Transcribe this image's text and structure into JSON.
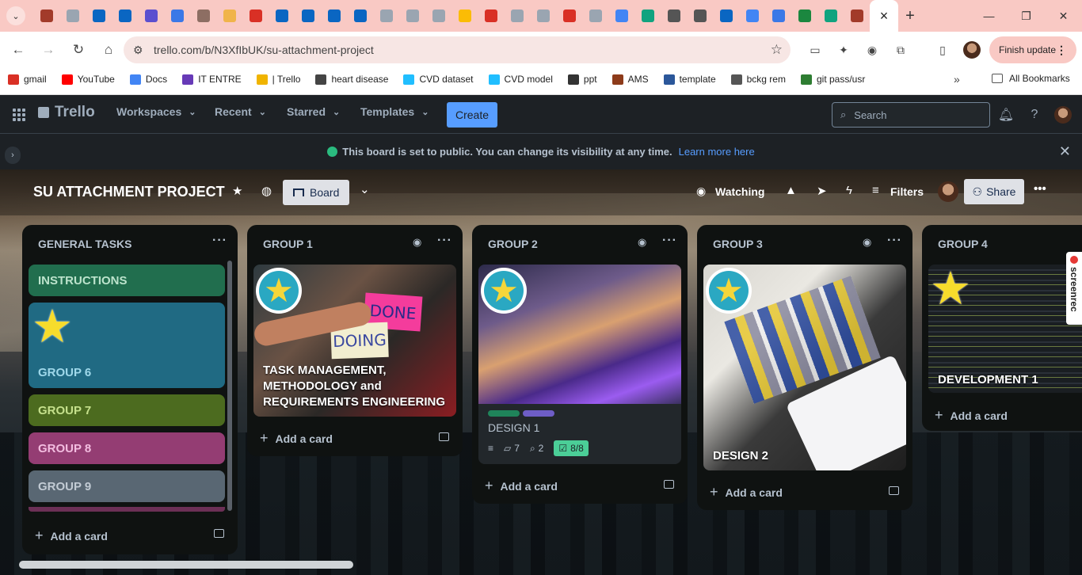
{
  "browser": {
    "tab_count_favicons": [
      "#a23b2a",
      "#9aa5b1",
      "#0a66c2",
      "#0a66c2",
      "#5b4fcf",
      "#3b78e7",
      "#8d6e63",
      "#f0b44a",
      "#d93025",
      "#0a66c2",
      "#0a66c2",
      "#0a66c2",
      "#0a66c2",
      "#9aa5b1",
      "#9aa5b1",
      "#9aa5b1",
      "#fbbc05",
      "#d93025",
      "#9aa5b1",
      "#9aa5b1",
      "#d93025",
      "#9aa5b1",
      "#4285f4",
      "#10a37f",
      "#555555",
      "#555555",
      "#0a66c2",
      "#4285f4",
      "#3b78e7",
      "#1b873f",
      "#10a37f",
      "#a23b2a"
    ],
    "active_tab_close": "×",
    "new_tab": "+",
    "url": "trello.com/b/N3XfIbUK/su-attachment-project",
    "update_button": "Finish update",
    "bookmarks": [
      {
        "label": "gmail",
        "color": "#d93025"
      },
      {
        "label": "YouTube",
        "color": "#ff0000"
      },
      {
        "label": "Docs",
        "color": "#4285f4"
      },
      {
        "label": "IT ENTRE",
        "color": "#673ab7"
      },
      {
        "label": "| Trello",
        "color": "#f0b400"
      },
      {
        "label": "heart disease",
        "color": "#444444"
      },
      {
        "label": "CVD dataset",
        "color": "#20beff"
      },
      {
        "label": "CVD model",
        "color": "#20beff"
      },
      {
        "label": "ppt",
        "color": "#333333"
      },
      {
        "label": "AMS",
        "color": "#8d3b1a"
      },
      {
        "label": "template",
        "color": "#2b579a"
      },
      {
        "label": "bckg rem",
        "color": "#555555"
      },
      {
        "label": "git pass/usr",
        "color": "#2e7d32"
      }
    ],
    "bookmarks_more": "»",
    "all_bookmarks": "All Bookmarks"
  },
  "trello": {
    "logo": "Trello",
    "nav": [
      "Workspaces",
      "Recent",
      "Starred",
      "Templates"
    ],
    "create": "Create",
    "search_placeholder": "Search",
    "banner_text": "This board is set to public. You can change its visibility at any time.",
    "banner_link": "Learn more here",
    "board_title": "SU ATTACHMENT PROJECT",
    "view": "Board",
    "watching": "Watching",
    "filters": "Filters",
    "share": "Share"
  },
  "lists": [
    {
      "title": "GENERAL TASKS",
      "cards": [
        {
          "label": "INSTRUCTIONS",
          "color": "#216e4e"
        },
        {
          "label": "GROUP 6",
          "color": "#206a83"
        },
        {
          "label": "GROUP 7",
          "color": "#4c6b1f"
        },
        {
          "label": "GROUP 8",
          "color": "#943d73"
        },
        {
          "label": "GROUP 9",
          "color": "#596773"
        }
      ],
      "add": "Add a card"
    },
    {
      "title": "GROUP 1",
      "cards": [
        {
          "label": "TASK MANAGEMENT, METHODOLOGY and REQUIREMENTS ENGINEERING",
          "note_done": "DONE",
          "note_doing": "DOING"
        }
      ],
      "add": "Add a card"
    },
    {
      "title": "GROUP 2",
      "cards": [
        {
          "label": "DESIGN 1",
          "label_colors": [
            "#1f845a",
            "#6e5dc6"
          ],
          "comments": "7",
          "attachments": "2",
          "checklist": "8/8"
        }
      ],
      "add": "Add a card"
    },
    {
      "title": "GROUP 3",
      "cards": [
        {
          "label": "DESIGN 2"
        }
      ],
      "add": "Add a card"
    },
    {
      "title": "GROUP 4",
      "cards": [
        {
          "label": "DEVELOPMENT 1"
        }
      ],
      "add": "Add a card"
    }
  ],
  "screenrec": "screenrec"
}
